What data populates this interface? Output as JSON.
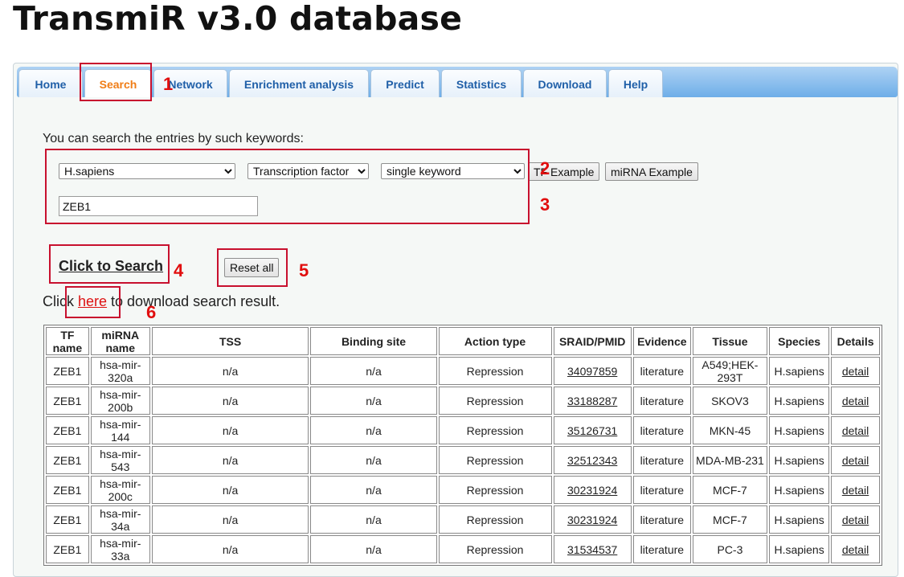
{
  "site": {
    "title": "TransmiR v3.0 database"
  },
  "nav": {
    "tabs": [
      {
        "label": "Home"
      },
      {
        "label": "Search"
      },
      {
        "label": "Network"
      },
      {
        "label": "Enrichment analysis"
      },
      {
        "label": "Predict"
      },
      {
        "label": "Statistics"
      },
      {
        "label": "Download"
      },
      {
        "label": "Help"
      }
    ],
    "active": "Search"
  },
  "search": {
    "intro": "You can search the entries by such keywords:",
    "species_selected": "H.sapiens",
    "type_selected": "Transcription factor",
    "mode_selected": "single keyword",
    "tf_example_label": "TF Example",
    "mirna_example_label": "miRNA Example",
    "keyword_value": "ZEB1",
    "click_to_search": "Click to Search",
    "reset_label": "Reset all",
    "download_prefix": "Click ",
    "download_link": "here",
    "download_suffix": " to download search result."
  },
  "annotations": [
    "1",
    "2",
    "3",
    "4",
    "5",
    "6"
  ],
  "table": {
    "headers": [
      "TF name",
      "miRNA name",
      "TSS",
      "Binding site",
      "Action type",
      "SRAID/PMID",
      "Evidence",
      "Tissue",
      "Species",
      "Details"
    ],
    "rows": [
      [
        "ZEB1",
        "hsa-mir-320a",
        "n/a",
        "n/a",
        "Repression",
        "34097859",
        "literature",
        "A549;HEK-293T",
        "H.sapiens",
        "detail"
      ],
      [
        "ZEB1",
        "hsa-mir-200b",
        "n/a",
        "n/a",
        "Repression",
        "33188287",
        "literature",
        "SKOV3",
        "H.sapiens",
        "detail"
      ],
      [
        "ZEB1",
        "hsa-mir-144",
        "n/a",
        "n/a",
        "Repression",
        "35126731",
        "literature",
        "MKN-45",
        "H.sapiens",
        "detail"
      ],
      [
        "ZEB1",
        "hsa-mir-543",
        "n/a",
        "n/a",
        "Repression",
        "32512343",
        "literature",
        "MDA-MB-231",
        "H.sapiens",
        "detail"
      ],
      [
        "ZEB1",
        "hsa-mir-200c",
        "n/a",
        "n/a",
        "Repression",
        "30231924",
        "literature",
        "MCF-7",
        "H.sapiens",
        "detail"
      ],
      [
        "ZEB1",
        "hsa-mir-34a",
        "n/a",
        "n/a",
        "Repression",
        "30231924",
        "literature",
        "MCF-7",
        "H.sapiens",
        "detail"
      ],
      [
        "ZEB1",
        "hsa-mir-33a",
        "n/a",
        "n/a",
        "Repression",
        "31534537",
        "literature",
        "PC-3",
        "H.sapiens",
        "detail"
      ]
    ]
  }
}
